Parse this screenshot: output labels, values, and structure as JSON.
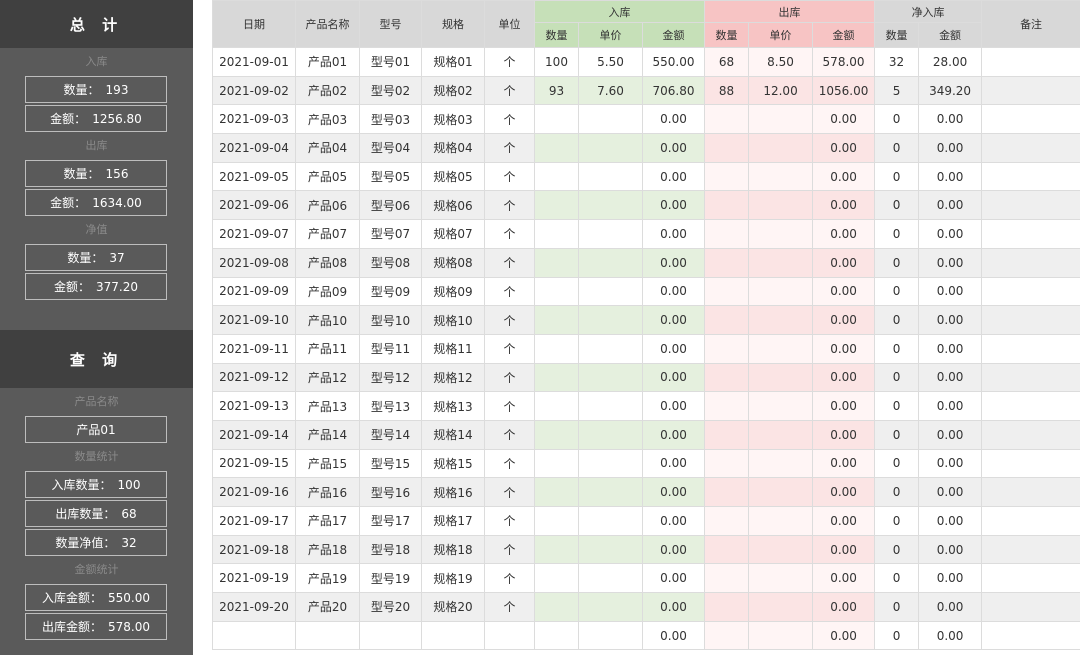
{
  "sidebar": {
    "total_title": "总 计",
    "in_label": "入库",
    "out_label": "出库",
    "net_label": "净值",
    "in_qty": {
      "k": "数量：",
      "v": "193"
    },
    "in_amt": {
      "k": "金额：",
      "v": "1256.80"
    },
    "out_qty": {
      "k": "数量：",
      "v": "156"
    },
    "out_amt": {
      "k": "金额：",
      "v": "1634.00"
    },
    "net_qty": {
      "k": "数量：",
      "v": "37"
    },
    "net_amt": {
      "k": "金额：",
      "v": "377.20"
    },
    "query_title": "查 询",
    "product_label": "产品名称",
    "product_value": "产品01",
    "qty_stat_label": "数量统计",
    "q_in_qty": {
      "k": "入库数量：",
      "v": "100"
    },
    "q_out_qty": {
      "k": "出库数量：",
      "v": "68"
    },
    "q_net_qty": {
      "k": "数量净值：",
      "v": "32"
    },
    "amt_stat_label": "金额统计",
    "q_in_amt": {
      "k": "入库金额：",
      "v": "550.00"
    },
    "q_out_amt": {
      "k": "出库金额：",
      "v": "578.00"
    }
  },
  "table": {
    "headers": {
      "date": "日期",
      "product": "产品名称",
      "model": "型号",
      "spec": "规格",
      "unit": "单位",
      "in_group": "入库",
      "out_group": "出库",
      "net_group": "净入库",
      "remark": "备注",
      "qty": "数量",
      "price": "单价",
      "amount": "金额"
    },
    "rows": [
      [
        "2021-09-01",
        "产品01",
        "型号01",
        "规格01",
        "个",
        "100",
        "5.50",
        "550.00",
        "68",
        "8.50",
        "578.00",
        "32",
        "28.00",
        ""
      ],
      [
        "2021-09-02",
        "产品02",
        "型号02",
        "规格02",
        "个",
        "93",
        "7.60",
        "706.80",
        "88",
        "12.00",
        "1056.00",
        "5",
        "349.20",
        ""
      ],
      [
        "2021-09-03",
        "产品03",
        "型号03",
        "规格03",
        "个",
        "",
        "",
        "0.00",
        "",
        "",
        "0.00",
        "0",
        "0.00",
        ""
      ],
      [
        "2021-09-04",
        "产品04",
        "型号04",
        "规格04",
        "个",
        "",
        "",
        "0.00",
        "",
        "",
        "0.00",
        "0",
        "0.00",
        ""
      ],
      [
        "2021-09-05",
        "产品05",
        "型号05",
        "规格05",
        "个",
        "",
        "",
        "0.00",
        "",
        "",
        "0.00",
        "0",
        "0.00",
        ""
      ],
      [
        "2021-09-06",
        "产品06",
        "型号06",
        "规格06",
        "个",
        "",
        "",
        "0.00",
        "",
        "",
        "0.00",
        "0",
        "0.00",
        ""
      ],
      [
        "2021-09-07",
        "产品07",
        "型号07",
        "规格07",
        "个",
        "",
        "",
        "0.00",
        "",
        "",
        "0.00",
        "0",
        "0.00",
        ""
      ],
      [
        "2021-09-08",
        "产品08",
        "型号08",
        "规格08",
        "个",
        "",
        "",
        "0.00",
        "",
        "",
        "0.00",
        "0",
        "0.00",
        ""
      ],
      [
        "2021-09-09",
        "产品09",
        "型号09",
        "规格09",
        "个",
        "",
        "",
        "0.00",
        "",
        "",
        "0.00",
        "0",
        "0.00",
        ""
      ],
      [
        "2021-09-10",
        "产品10",
        "型号10",
        "规格10",
        "个",
        "",
        "",
        "0.00",
        "",
        "",
        "0.00",
        "0",
        "0.00",
        ""
      ],
      [
        "2021-09-11",
        "产品11",
        "型号11",
        "规格11",
        "个",
        "",
        "",
        "0.00",
        "",
        "",
        "0.00",
        "0",
        "0.00",
        ""
      ],
      [
        "2021-09-12",
        "产品12",
        "型号12",
        "规格12",
        "个",
        "",
        "",
        "0.00",
        "",
        "",
        "0.00",
        "0",
        "0.00",
        ""
      ],
      [
        "2021-09-13",
        "产品13",
        "型号13",
        "规格13",
        "个",
        "",
        "",
        "0.00",
        "",
        "",
        "0.00",
        "0",
        "0.00",
        ""
      ],
      [
        "2021-09-14",
        "产品14",
        "型号14",
        "规格14",
        "个",
        "",
        "",
        "0.00",
        "",
        "",
        "0.00",
        "0",
        "0.00",
        ""
      ],
      [
        "2021-09-15",
        "产品15",
        "型号15",
        "规格15",
        "个",
        "",
        "",
        "0.00",
        "",
        "",
        "0.00",
        "0",
        "0.00",
        ""
      ],
      [
        "2021-09-16",
        "产品16",
        "型号16",
        "规格16",
        "个",
        "",
        "",
        "0.00",
        "",
        "",
        "0.00",
        "0",
        "0.00",
        ""
      ],
      [
        "2021-09-17",
        "产品17",
        "型号17",
        "规格17",
        "个",
        "",
        "",
        "0.00",
        "",
        "",
        "0.00",
        "0",
        "0.00",
        ""
      ],
      [
        "2021-09-18",
        "产品18",
        "型号18",
        "规格18",
        "个",
        "",
        "",
        "0.00",
        "",
        "",
        "0.00",
        "0",
        "0.00",
        ""
      ],
      [
        "2021-09-19",
        "产品19",
        "型号19",
        "规格19",
        "个",
        "",
        "",
        "0.00",
        "",
        "",
        "0.00",
        "0",
        "0.00",
        ""
      ],
      [
        "2021-09-20",
        "产品20",
        "型号20",
        "规格20",
        "个",
        "",
        "",
        "0.00",
        "",
        "",
        "0.00",
        "0",
        "0.00",
        ""
      ],
      [
        "",
        "",
        "",
        "",
        "",
        "",
        "",
        "0.00",
        "",
        "",
        "0.00",
        "0",
        "0.00",
        ""
      ]
    ]
  }
}
